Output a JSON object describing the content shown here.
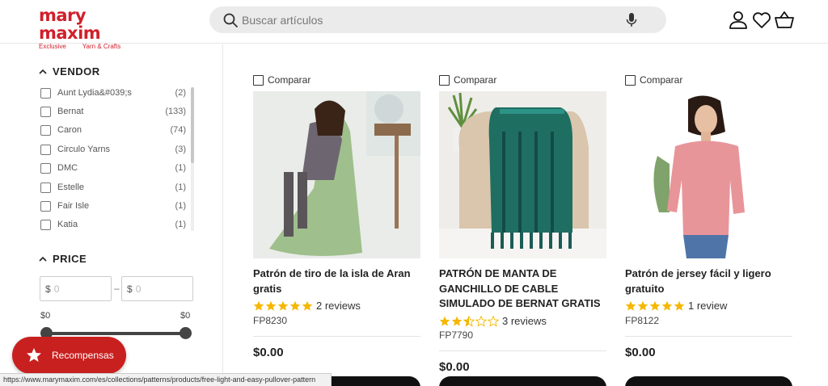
{
  "brand": {
    "name": "mary maxim",
    "tag_left": "Exclusive",
    "tag_right": "Yarn & Crafts"
  },
  "search": {
    "placeholder": "Buscar artículos"
  },
  "header_icons": [
    "user-icon",
    "heart-icon",
    "cart-icon"
  ],
  "filters": {
    "vendor": {
      "title": "VENDOR",
      "items": [
        {
          "label": "Aunt Lydia&#039;s",
          "count": "(2)"
        },
        {
          "label": "Bernat",
          "count": "(133)"
        },
        {
          "label": "Caron",
          "count": "(74)"
        },
        {
          "label": "Circulo Yarns",
          "count": "(3)"
        },
        {
          "label": "DMC",
          "count": "(1)"
        },
        {
          "label": "Estelle",
          "count": "(1)"
        },
        {
          "label": "Fair Isle",
          "count": "(1)"
        },
        {
          "label": "Katia",
          "count": "(1)"
        }
      ]
    },
    "price": {
      "title": "PRICE",
      "currency": "$",
      "min_placeholder": "0",
      "max_placeholder": "0",
      "dash": "–",
      "min_value": "$0",
      "max_value": "$0"
    }
  },
  "rewards": {
    "label": "Recompensas"
  },
  "products": [
    {
      "compare": "Comparar",
      "title": "Patrón de tiro de la isla de Aran gratis",
      "rating": 5,
      "reviews": "2 reviews",
      "sku": "FP8230",
      "price": "$0.00"
    },
    {
      "compare": "Comparar",
      "title": "PATRÓN DE MANTA DE GANCHILLO DE CABLE SIMULADO DE BERNAT GRATIS",
      "rating": 2.5,
      "reviews": "3 reviews",
      "sku": "FP7790",
      "price": "$0.00"
    },
    {
      "compare": "Comparar",
      "title": "Patrón de jersey fácil y ligero gratuito",
      "rating": 5,
      "reviews": "1 review",
      "sku": "FP8122",
      "price": "$0.00"
    }
  ],
  "status_url": "https://www.marymaxim.com/es/collections/patterns/products/free-light-and-easy-pullover-pattern",
  "colors": {
    "brand_red": "#d0202b",
    "rewards_red": "#c8201f",
    "star": "#f5b700",
    "search_bg": "#ebebeb"
  }
}
